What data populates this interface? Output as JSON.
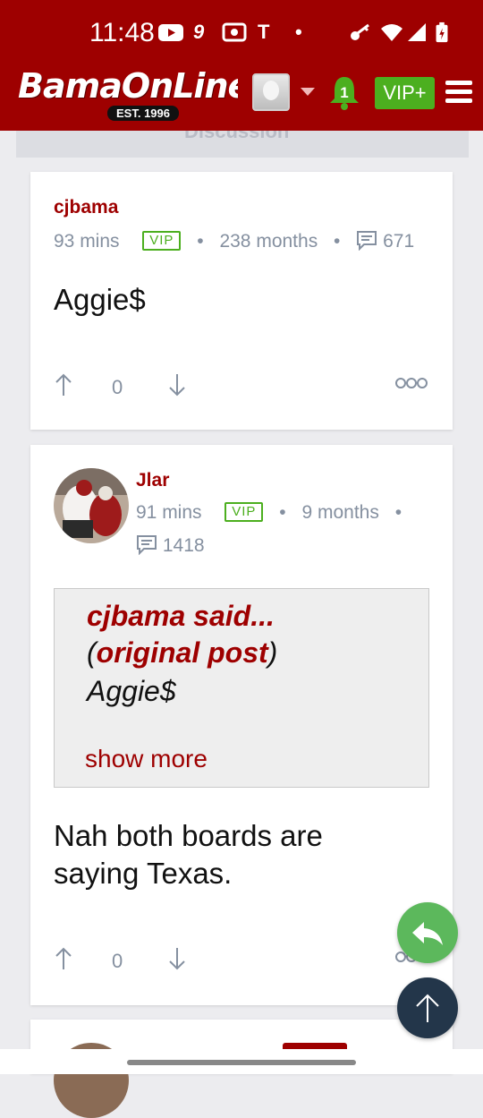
{
  "status_bar": {
    "time": "11:48",
    "icons": [
      "youtube-icon",
      "app-9-icon",
      "radio-icon",
      "t-mobile-icon",
      "dot-icon",
      "key-icon",
      "wifi-icon",
      "signal-icon",
      "battery-icon"
    ]
  },
  "header": {
    "logo_text": "BamaOnLine",
    "logo_est": "EST. 1996",
    "notification_count": "1",
    "vip_label": "VIP+",
    "colors": {
      "brand": "#9e0000",
      "vip": "#4caf1f"
    }
  },
  "section_label": "Discussion",
  "posts": [
    {
      "author": "cjbama",
      "time": "93 mins",
      "vip": "VIP",
      "tenure": "238 months",
      "post_count": "671",
      "body": "Aggie$",
      "votes": "0"
    },
    {
      "author": "Jlar",
      "time": "91 mins",
      "vip": "VIP",
      "tenure": "9 months",
      "post_count": "1418",
      "quote": {
        "author_line": "cjbama said...",
        "open_paren": "(",
        "link": "original post",
        "close_paren": ")",
        "text": "Aggie$",
        "show_more": "show more"
      },
      "body_lines": [
        "Nah both boards are",
        "saying Texas."
      ],
      "votes": "0"
    }
  ]
}
